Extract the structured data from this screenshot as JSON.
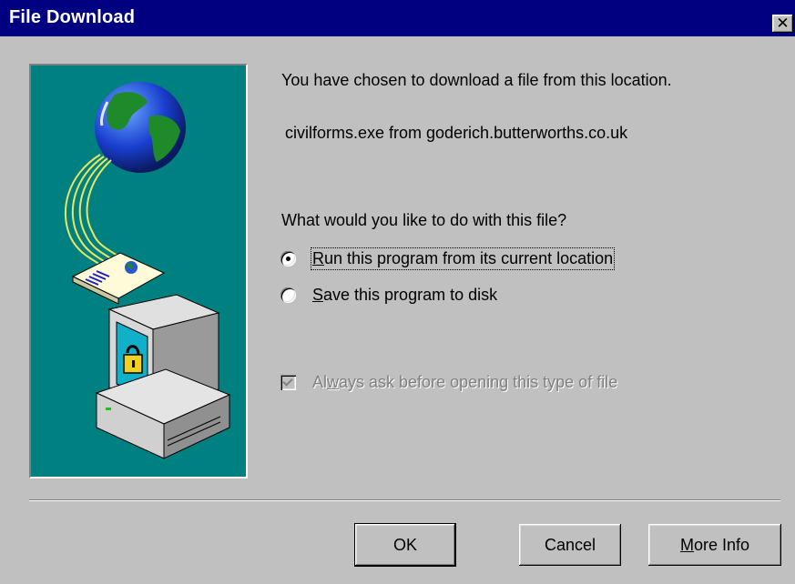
{
  "window": {
    "title": "File Download",
    "close_glyph": "✕"
  },
  "illustration": {
    "icon": "download-globe-computer-illustration"
  },
  "message": {
    "line1": "You have chosen to download a file from this location.",
    "source": "civilforms.exe from goderich.butterworths.co.uk",
    "question": "What would you like to do with this file?"
  },
  "options": {
    "run_prefix": "R",
    "run_rest": "un this program from its current location",
    "run_selected": true,
    "save_prefix": "S",
    "save_rest": "ave this program to disk",
    "save_selected": false
  },
  "always_ask": {
    "prefix": "Al",
    "accel": "w",
    "rest": "ays ask before opening this type of file",
    "checked": true,
    "enabled": false
  },
  "buttons": {
    "ok": "OK",
    "cancel": "Cancel",
    "more_info_accel": "M",
    "more_info_rest": "ore Info"
  },
  "colors": {
    "titlebar": "#000080",
    "face": "#c0c0c0",
    "illustration_bg": "#008080"
  }
}
